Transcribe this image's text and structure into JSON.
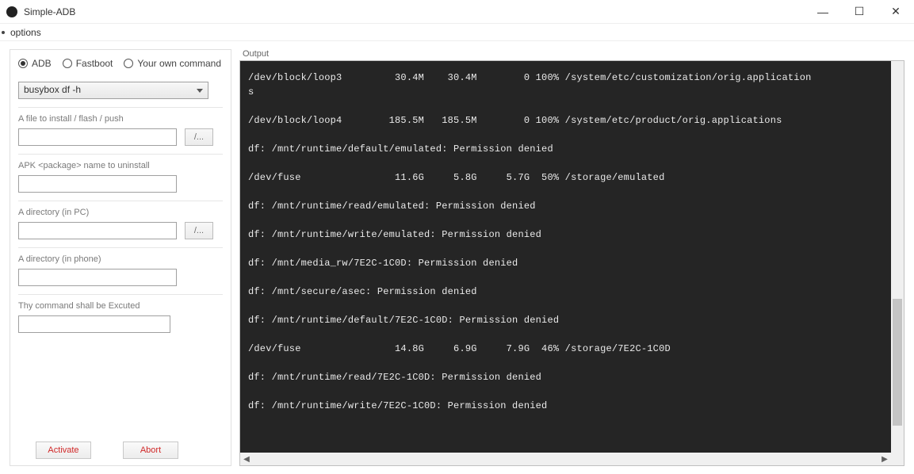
{
  "window": {
    "title": "Simple-ADB"
  },
  "menu": {
    "options": "options"
  },
  "mode": {
    "adb": "ADB",
    "fastboot": "Fastboot",
    "own": "Your own command"
  },
  "combo": {
    "value": "busybox df -h"
  },
  "groups": {
    "file": "A file to install / flash / push",
    "apk": "APK <package> name to uninstall",
    "dir_pc": "A directory (in PC)",
    "dir_phone": "A directory (in phone)",
    "cmd": "Thy command shall be Excuted"
  },
  "browse_label": "/...",
  "buttons": {
    "activate": "Activate",
    "abort": "Abort"
  },
  "output_label": "Output",
  "terminal_text": "/dev/block/loop3         30.4M    30.4M        0 100% /system/etc/customization/orig.application\ns\n\n/dev/block/loop4        185.5M   185.5M        0 100% /system/etc/product/orig.applications\n\ndf: /mnt/runtime/default/emulated: Permission denied\n\n/dev/fuse                11.6G     5.8G     5.7G  50% /storage/emulated\n\ndf: /mnt/runtime/read/emulated: Permission denied\n\ndf: /mnt/runtime/write/emulated: Permission denied\n\ndf: /mnt/media_rw/7E2C-1C0D: Permission denied\n\ndf: /mnt/secure/asec: Permission denied\n\ndf: /mnt/runtime/default/7E2C-1C0D: Permission denied\n\n/dev/fuse                14.8G     6.9G     7.9G  46% /storage/7E2C-1C0D\n\ndf: /mnt/runtime/read/7E2C-1C0D: Permission denied\n\ndf: /mnt/runtime/write/7E2C-1C0D: Permission denied"
}
